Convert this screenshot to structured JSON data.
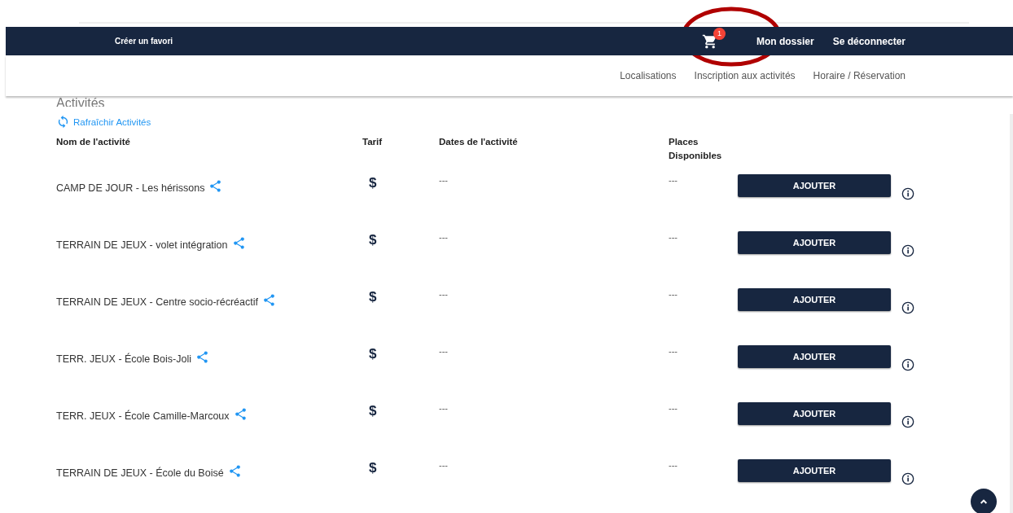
{
  "navbar": {
    "favorite_link": "Créer un favori",
    "cart_count": "1",
    "links": [
      "Mon dossier",
      "Se déconnecter"
    ]
  },
  "subnav": {
    "links": [
      "Localisations",
      "Inscription aux activités",
      "Horaire / Réservation"
    ]
  },
  "heading": "Activités",
  "refresh_link": "Rafraîchir Activités",
  "table": {
    "columns": [
      "Nom de l'activité",
      "Tarif",
      "Dates de l'activité",
      "Places Disponibles"
    ],
    "rows": [
      {
        "name": "CAMP DE JOUR - Les hérissons",
        "tarif": "$",
        "dates": "---",
        "places": "---",
        "button": "AJOUTER"
      },
      {
        "name": "TERRAIN DE JEUX - volet intégration",
        "tarif": "$",
        "dates": "---",
        "places": "---",
        "button": "AJOUTER"
      },
      {
        "name": "TERRAIN DE JEUX - Centre socio-récréactif",
        "tarif": "$",
        "dates": "---",
        "places": "---",
        "button": "AJOUTER"
      },
      {
        "name": "TERR. JEUX - École Bois-Joli",
        "tarif": "$",
        "dates": "---",
        "places": "---",
        "button": "AJOUTER"
      },
      {
        "name": "TERR. JEUX - École Camille-Marcoux",
        "tarif": "$",
        "dates": "---",
        "places": "---",
        "button": "AJOUTER"
      },
      {
        "name": "TERRAIN DE JEUX - École du Boisé",
        "tarif": "$",
        "dates": "---",
        "places": "---",
        "button": "AJOUTER"
      }
    ]
  }
}
